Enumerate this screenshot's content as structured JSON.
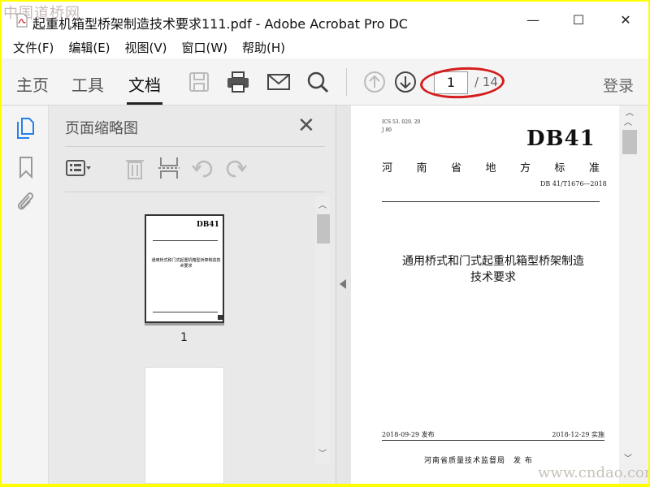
{
  "window": {
    "title": "起重机箱型桥架制造技术要求111.pdf - Adobe Acrobat Pro DC",
    "minimize": "—",
    "maximize": "☐",
    "close": "✕"
  },
  "watermarks": {
    "top": "中国道桥网",
    "bottom": "www.cndao.com"
  },
  "menu": [
    "文件(F)",
    "编辑(E)",
    "视图(V)",
    "窗口(W)",
    "帮助(H)"
  ],
  "toolbar": {
    "tabs": [
      {
        "label": "主页"
      },
      {
        "label": "工具"
      },
      {
        "label": "文档",
        "active": true
      }
    ],
    "current_page": "1",
    "total_pages": "/ 14",
    "login": "登录"
  },
  "panel": {
    "title": "页面缩略图",
    "thumb_label": "1",
    "thumb": {
      "db": "DB41",
      "title": "通用桥式和门式起重机箱型桥架制造技术要求"
    }
  },
  "document": {
    "ics": "ICS 53. 020. 20",
    "classification": "J 80",
    "code": "DB41",
    "standard_title": [
      "河",
      "南",
      "省",
      "地",
      "方",
      "标",
      "准"
    ],
    "standard_number": "DB 41/T1676—2018",
    "title_line1": "通用桥式和门式起重机箱型桥架制造",
    "title_line2": "技术要求",
    "issue_date": "2018-09-29 发布",
    "implement_date": "2018-12-29 实施",
    "publisher": "河南省质量技术监督局　发 布"
  },
  "colors": {
    "highlight_ellipse": "#d61c1c",
    "border": "#ffff00"
  }
}
